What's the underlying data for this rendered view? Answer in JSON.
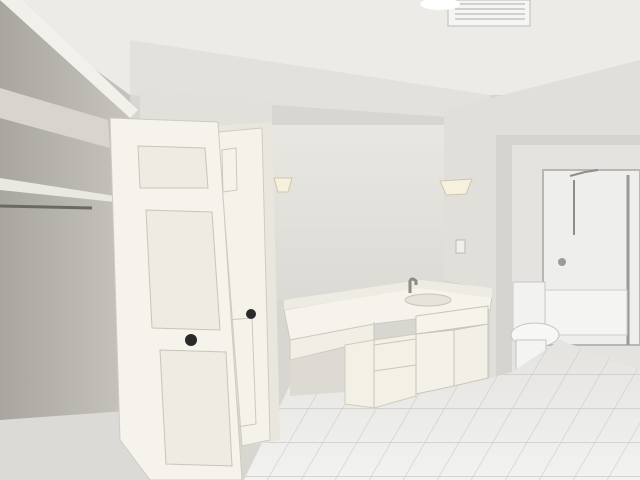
{
  "scene": {
    "description_tags": [
      "bathroom",
      "vanity",
      "closet",
      "shower"
    ],
    "colors": {
      "wall": "#e6e4df",
      "ceiling": "#eeede9",
      "floor_tile": "#eeeeec",
      "grout": "#c9c8c4",
      "cabinet": "#f3f0e6",
      "door": "#f4f1e9",
      "closet_interior": "#bfbcb6"
    }
  }
}
